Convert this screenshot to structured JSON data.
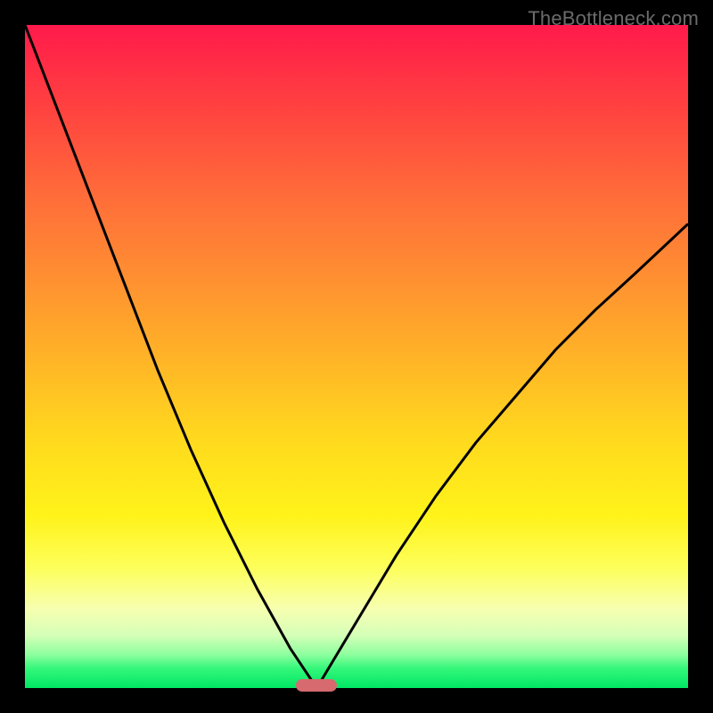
{
  "watermark": "TheBottleneck.com",
  "chart_data": {
    "type": "line",
    "title": "",
    "xlabel": "",
    "ylabel": "",
    "xlim": [
      0,
      1
    ],
    "ylim": [
      0,
      1
    ],
    "grid": false,
    "legend": false,
    "marker": {
      "x": 0.44,
      "color": "#d66a6f"
    },
    "background_gradient": {
      "top": "#ff1a4b",
      "mid": "#ffd81e",
      "bottom": "#00e765"
    },
    "series": [
      {
        "name": "left-branch",
        "x": [
          0.0,
          0.05,
          0.1,
          0.15,
          0.2,
          0.25,
          0.3,
          0.35,
          0.4,
          0.44
        ],
        "y": [
          1.0,
          0.87,
          0.74,
          0.61,
          0.48,
          0.36,
          0.25,
          0.15,
          0.06,
          0.0
        ]
      },
      {
        "name": "right-branch",
        "x": [
          0.44,
          0.5,
          0.56,
          0.62,
          0.68,
          0.74,
          0.8,
          0.86,
          0.92,
          1.0
        ],
        "y": [
          0.0,
          0.1,
          0.2,
          0.29,
          0.37,
          0.44,
          0.51,
          0.57,
          0.625,
          0.7
        ]
      }
    ]
  }
}
